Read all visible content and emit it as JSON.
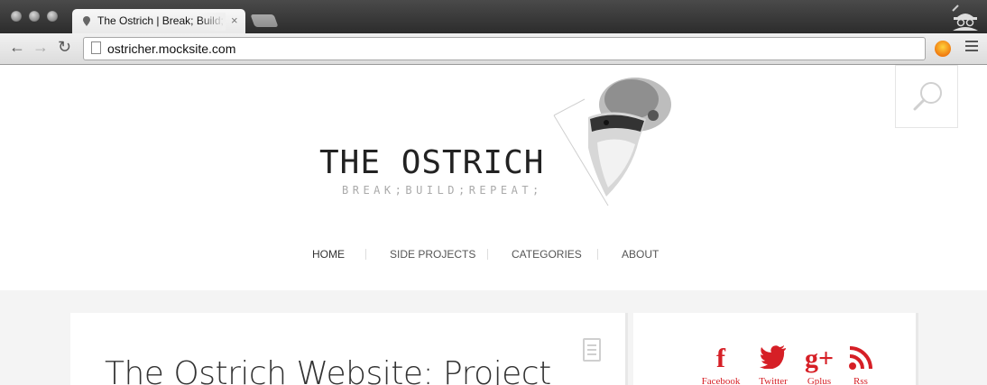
{
  "browser": {
    "tab_title": "The Ostrich | Break; Build; Repeat;",
    "tab_close": "×",
    "url": "ostricher.mocksite.com",
    "back_icon": "arrow-left",
    "forward_icon": "arrow-right",
    "reload_icon": "reload",
    "back_glyph": "←",
    "forward_glyph": "→",
    "reload_glyph": "↻"
  },
  "site": {
    "title": "THE OSTRICH",
    "tagline": "BREAK;BUILD;REPEAT;"
  },
  "nav": {
    "items": [
      {
        "label": "HOME"
      },
      {
        "label": "SIDE PROJECTS"
      },
      {
        "label": "CATEGORIES"
      },
      {
        "label": "ABOUT"
      }
    ]
  },
  "post": {
    "title": "The Ostrich Website: Project"
  },
  "social": {
    "items": [
      {
        "icon": "facebook-icon",
        "glyph": "f",
        "label": "Facebook"
      },
      {
        "icon": "twitter-icon",
        "glyph": "🐦",
        "label": "Twitter"
      },
      {
        "icon": "google-plus-icon",
        "glyph": "g+",
        "label": "Gplus"
      },
      {
        "icon": "rss-icon",
        "glyph": "◉",
        "label": "Rss"
      }
    ]
  },
  "colors": {
    "accent_red": "#d61f26",
    "chrome_dark": "#2c2c2c",
    "page_bg": "#ffffff",
    "content_bg": "#f4f4f4"
  }
}
